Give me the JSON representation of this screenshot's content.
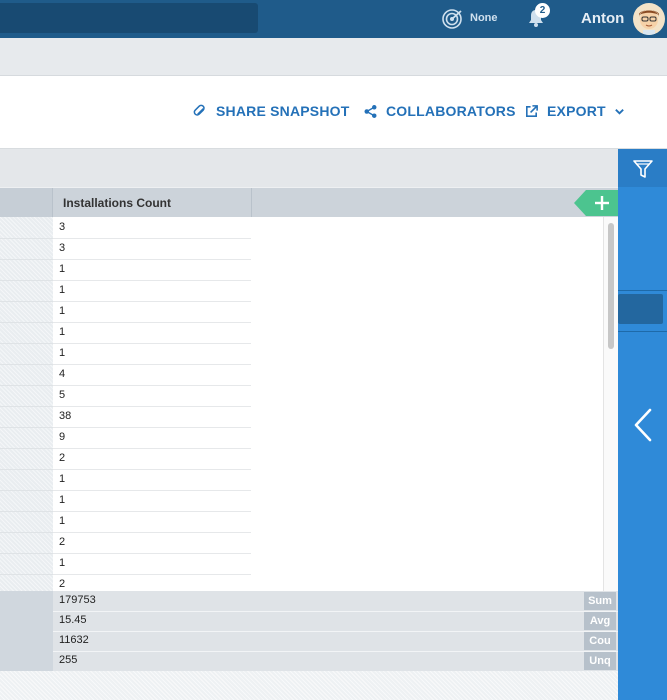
{
  "topbar": {
    "radar_label": "None",
    "notification_count": "2",
    "user_name": "Anton"
  },
  "actions": {
    "share": "SHARE SNAPSHOT",
    "collaborators": "COLLABORATORS",
    "export": "EXPORT"
  },
  "grid": {
    "column_header": "Installations Count",
    "rows": [
      "3",
      "3",
      "1",
      "1",
      "1",
      "1",
      "1",
      "4",
      "5",
      "38",
      "9",
      "2",
      "1",
      "1",
      "1",
      "2",
      "1",
      "2"
    ],
    "totals": [
      {
        "value": "179753",
        "tag": "Sum"
      },
      {
        "value": "15.45",
        "tag": "Avg"
      },
      {
        "value": "11632",
        "tag": "Cou"
      },
      {
        "value": "255",
        "tag": "Unq"
      }
    ]
  },
  "colors": {
    "topbar": "#1f5b8a",
    "accent": "#2471b8",
    "rail": "#2f8ad8",
    "add_button": "#4cc48f"
  },
  "icons": [
    "radar-icon",
    "bell-icon",
    "avatar",
    "share-icon",
    "collaborators-icon",
    "export-icon",
    "chevron-down-icon",
    "filter-icon",
    "plus-icon",
    "chevron-left-icon"
  ]
}
